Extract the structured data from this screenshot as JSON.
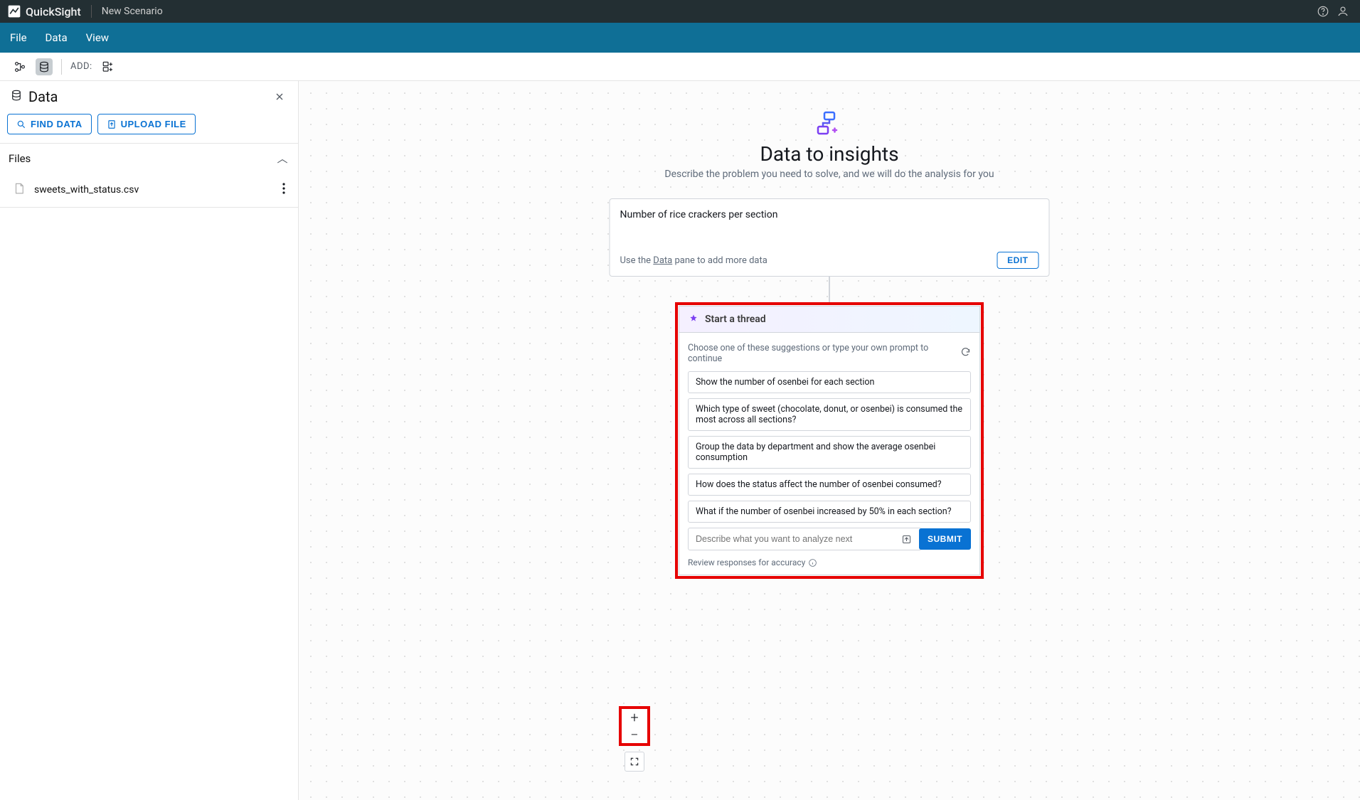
{
  "topbar": {
    "product": "QuickSight",
    "scenario": "New Scenario"
  },
  "menubar": {
    "file": "File",
    "data": "Data",
    "view": "View"
  },
  "toolbar": {
    "add_label": "ADD:"
  },
  "sidebar": {
    "title": "Data",
    "find_data": "FIND DATA",
    "upload_file": "UPLOAD FILE",
    "files_header": "Files",
    "files": [
      {
        "name": "sweets_with_status.csv"
      }
    ]
  },
  "hero": {
    "title": "Data to insights",
    "subtitle": "Describe the problem you need to solve, and we will do the analysis for you"
  },
  "card": {
    "question": "Number of rice crackers per section",
    "hint_pre": "Use the ",
    "hint_link": "Data",
    "hint_post": " pane to add more data",
    "edit": "EDIT"
  },
  "thread": {
    "title": "Start a thread",
    "choose": "Choose one of these suggestions or type your own prompt to continue",
    "suggestions": [
      "Show the number of osenbei for each section",
      "Which type of sweet (chocolate, donut, or osenbei) is consumed the most across all sections?",
      "Group the data by department and show the average osenbei consumption",
      "How does the status affect the number of osenbei consumed?",
      "What if the number of osenbei increased by 50% in each section?"
    ],
    "placeholder": "Describe what you want to analyze next",
    "submit": "SUBMIT",
    "review": "Review responses for accuracy"
  },
  "zoom": {
    "in": "+",
    "out": "−"
  }
}
